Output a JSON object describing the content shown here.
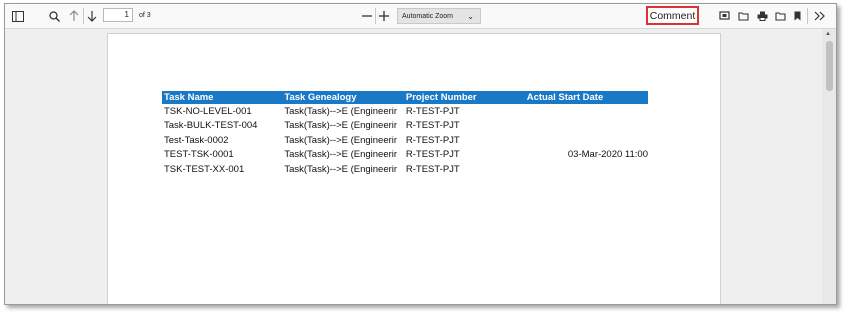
{
  "toolbar": {
    "page_number": "1",
    "page_count": "of 3",
    "zoom_label": "Automatic Zoom",
    "comment_label": "Comment"
  },
  "table": {
    "headers": [
      "Task Name",
      "Task Genealogy",
      "Project Number",
      "Actual Start Date"
    ],
    "rows": [
      [
        "TSK-NO-LEVEL-001",
        "Task(Task)-->E (Engineerir",
        "R-TEST-PJT",
        ""
      ],
      [
        "Task-BULK-TEST-004",
        "Task(Task)-->E (Engineerir",
        "R-TEST-PJT",
        ""
      ],
      [
        "Test-Task-0002",
        "Task(Task)-->E (Engineerir",
        "R-TEST-PJT",
        ""
      ],
      [
        "TEST-TSK-0001",
        "Task(Task)-->E (Engineerir",
        "R-TEST-PJT",
        "03-Mar-2020 11:00"
      ],
      [
        "TSK-TEST-XX-001",
        "Task(Task)-->E (Engineerir",
        "R-TEST-PJT",
        ""
      ]
    ]
  },
  "colors": {
    "header_bg": "#1a79c6",
    "highlight": "#d83434"
  }
}
